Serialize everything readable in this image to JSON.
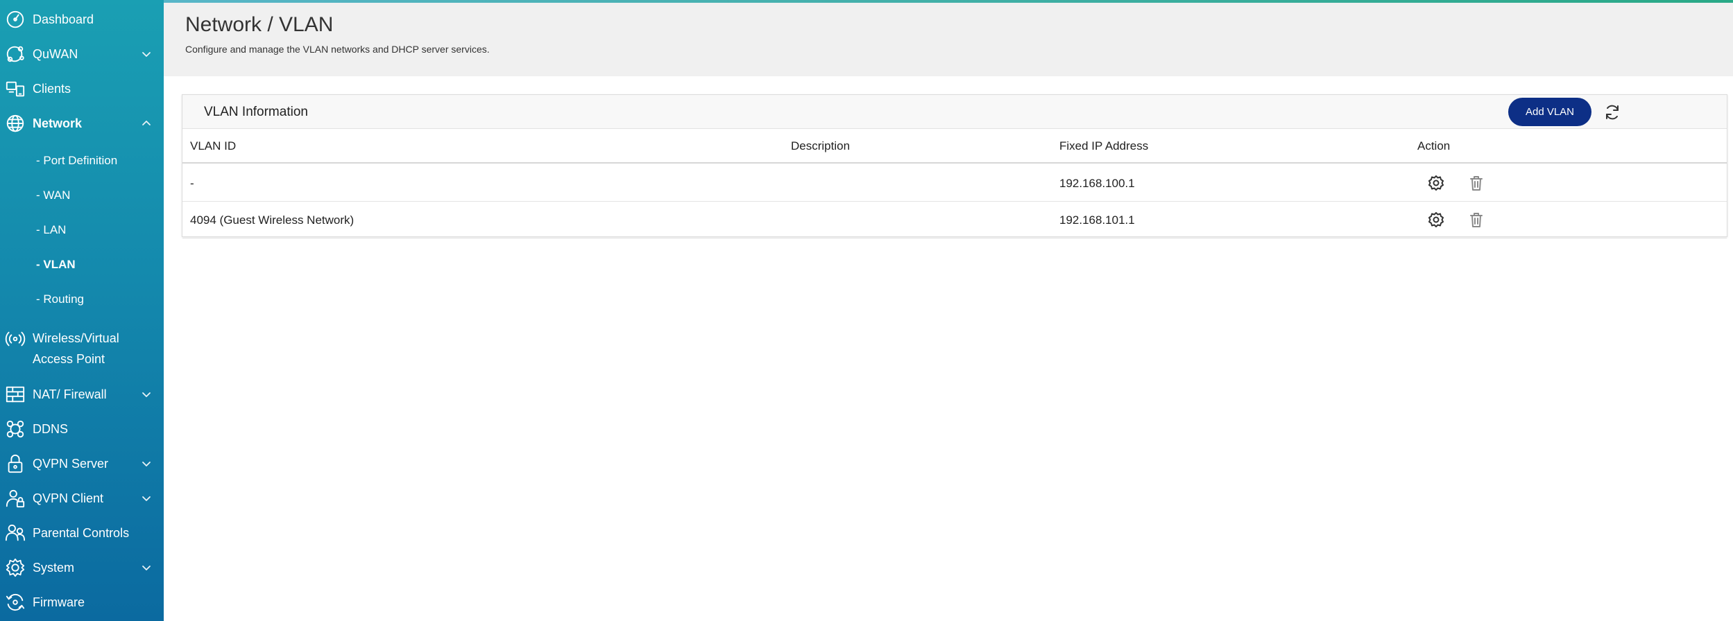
{
  "sidebar": {
    "items": [
      {
        "label": "Dashboard",
        "icon": "dashboard-icon"
      },
      {
        "label": "QuWAN",
        "icon": "quwan-icon"
      },
      {
        "label": "Clients",
        "icon": "clients-icon"
      },
      {
        "label": "Network",
        "icon": "globe-icon"
      },
      {
        "label": "Wireless/Virtual Access Point",
        "icon": "wireless-icon"
      },
      {
        "label": "NAT/ Firewall",
        "icon": "firewall-icon"
      },
      {
        "label": "DDNS",
        "icon": "ddns-icon"
      },
      {
        "label": "QVPN Server",
        "icon": "lock-icon"
      },
      {
        "label": "QVPN Client",
        "icon": "vpn-client-icon"
      },
      {
        "label": "Parental Controls",
        "icon": "parental-icon"
      },
      {
        "label": "System",
        "icon": "gear-icon"
      },
      {
        "label": "Firmware",
        "icon": "firmware-icon"
      }
    ],
    "network_sub": [
      {
        "label": "- Port Definition"
      },
      {
        "label": "- WAN"
      },
      {
        "label": "- LAN"
      },
      {
        "label": "- VLAN"
      },
      {
        "label": "- Routing"
      }
    ]
  },
  "header": {
    "title": "Network / VLAN",
    "subtitle": "Configure and manage the VLAN networks and DHCP server services."
  },
  "card": {
    "title": "VLAN Information",
    "add_button": "Add VLAN",
    "columns": [
      "VLAN ID",
      "Description",
      "Fixed IP Address",
      "Action"
    ],
    "rows": [
      {
        "vlan_id": "-",
        "description": "",
        "ip": "192.168.100.1"
      },
      {
        "vlan_id": "4094 (Guest Wireless Network)",
        "description": "",
        "ip": "192.168.101.1"
      }
    ]
  },
  "colors": {
    "sidebar_top": "#1a9fb3",
    "sidebar_bottom": "#0b6aa0",
    "primary_button": "#0d2f86",
    "header_bg": "#f0f0f0"
  }
}
